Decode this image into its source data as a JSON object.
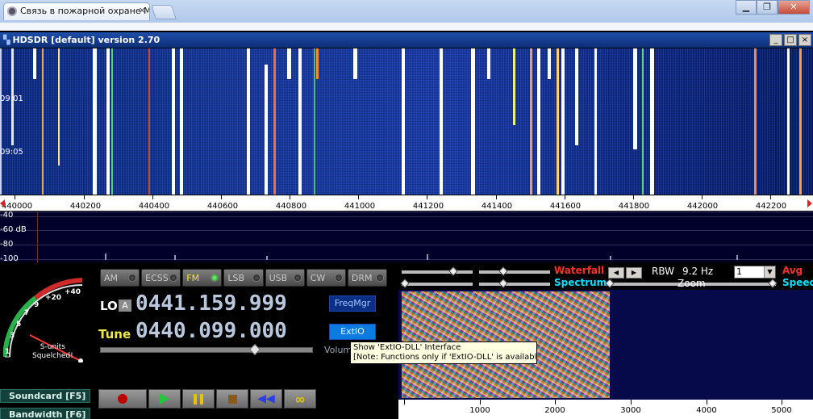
{
  "browser": {
    "tab_title": "Связь в пожарной охране Мо",
    "tab_close": "×",
    "window_buttons": [
      "▁",
      "❐",
      "✕"
    ]
  },
  "app": {
    "title": "HDSDR [default]  version 2.70",
    "controls": [
      "_",
      "□",
      "×"
    ]
  },
  "waterfall": {
    "time_labels": [
      "09:01",
      "09:05"
    ],
    "freq_labels": [
      "440000",
      "440200",
      "440400",
      "440600",
      "440800",
      "441000",
      "441200",
      "441400",
      "441600",
      "441800",
      "442000",
      "442200"
    ]
  },
  "spectrum": {
    "db_labels": [
      "-40",
      "-60 dB",
      "-80",
      "-100"
    ]
  },
  "modes": [
    {
      "label": "AM",
      "active": false
    },
    {
      "label": "ECSS",
      "active": false
    },
    {
      "label": "FM",
      "active": true
    },
    {
      "label": "LSB",
      "active": false
    },
    {
      "label": "USB",
      "active": false
    },
    {
      "label": "CW",
      "active": false
    },
    {
      "label": "DRM",
      "active": false
    }
  ],
  "smeter": {
    "scale": [
      "1",
      "3",
      "5",
      "7",
      "9",
      "+20",
      "+40"
    ],
    "squelch_line1": "S-units",
    "squelch_line2": "Squelched!"
  },
  "lo": {
    "label": "LO",
    "a_button": "A",
    "value": "0441.159.999"
  },
  "tune": {
    "label": "Tune",
    "value": "0440.099.000"
  },
  "buttons": {
    "freqmgr": "FreqMgr",
    "extio": "ExtIO",
    "volume": "Volum"
  },
  "side_buttons": {
    "soundcard": "Soundcard  [F5]",
    "bandwidth": "Bandwidth  [F6]"
  },
  "display_controls": {
    "waterfall": "Waterfall",
    "spectrum": "Spectrum",
    "rbw": "RBW",
    "rbw_value": "9.2 Hz",
    "zoom": "Zoom",
    "avg_value": "1",
    "avg": "Avg",
    "speed": "Speed"
  },
  "audio_scale": [
    "1000",
    "2000",
    "3000",
    "4000",
    "5000"
  ],
  "tooltip": {
    "line1": "Show 'ExtIO-DLL' Interface",
    "line2": "[Note: Functions only if 'ExtIO-DLL' is available]"
  },
  "colors": {
    "waterfall_bg": "#17389b",
    "lcd_text": "#b9c8dc",
    "tune_label": "#f1e84a",
    "active_mode": "#f2e23b",
    "waterfall_label": "#ff3030",
    "spectrum_label": "#00e0ff"
  }
}
